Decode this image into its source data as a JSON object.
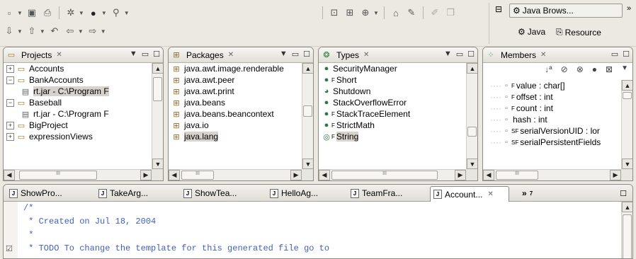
{
  "perspectives": {
    "current_label": "Java Brows...",
    "java_label": "Java",
    "resource_label": "Resource",
    "more_label": "»"
  },
  "views": {
    "projects": {
      "title": "Projects",
      "items": [
        {
          "label": "Accounts",
          "twisty": "+"
        },
        {
          "label": "BankAccounts",
          "twisty": "−"
        },
        {
          "label": "rt.jar - C:\\Program F"
        },
        {
          "label": "Baseball",
          "twisty": "−"
        },
        {
          "label": "rt.jar - C:\\Program F"
        },
        {
          "label": "BigProject",
          "twisty": "+"
        },
        {
          "label": "expressionViews",
          "twisty": "+"
        }
      ],
      "hscroll_grip": "III"
    },
    "packages": {
      "title": "Packages",
      "items": [
        "java.awt.image.renderable",
        "java.awt.peer",
        "java.awt.print",
        "java.beans",
        "java.beans.beancontext",
        "java.io",
        "java.lang"
      ],
      "hscroll_grip": "III"
    },
    "types": {
      "title": "Types",
      "items": [
        {
          "label": "SecurityManager",
          "mod": ""
        },
        {
          "label": "Short",
          "mod": "F"
        },
        {
          "label": "Shutdown",
          "mod": ""
        },
        {
          "label": "StackOverflowError",
          "mod": ""
        },
        {
          "label": "StackTraceElement",
          "mod": "F"
        },
        {
          "label": "StrictMath",
          "mod": "F"
        },
        {
          "label": "String",
          "mod": "F"
        }
      ],
      "hscroll_grip": "III"
    },
    "members": {
      "title": "Members",
      "items": [
        {
          "mod": "F",
          "label": "value : char[]"
        },
        {
          "mod": "F",
          "label": "offset : int"
        },
        {
          "mod": "F",
          "label": "count : int"
        },
        {
          "mod": "",
          "label": "hash : int"
        },
        {
          "mod": "SF",
          "label": "serialVersionUID : lor"
        },
        {
          "mod": "SF",
          "label": "serialPersistentFields"
        }
      ],
      "hscroll_grip": "III"
    }
  },
  "editor": {
    "tabs": [
      "ShowPro...",
      "TakeArg...",
      "ShowTea...",
      "HelloAg...",
      "TeamFra...",
      "Account..."
    ],
    "active_tab": 5,
    "overflow_label": "»",
    "overflow_count": "7",
    "code_lines": [
      "/*",
      " * Created on Jul 18, 2004",
      " *",
      " * TODO To change the template for this generated file go to"
    ]
  }
}
